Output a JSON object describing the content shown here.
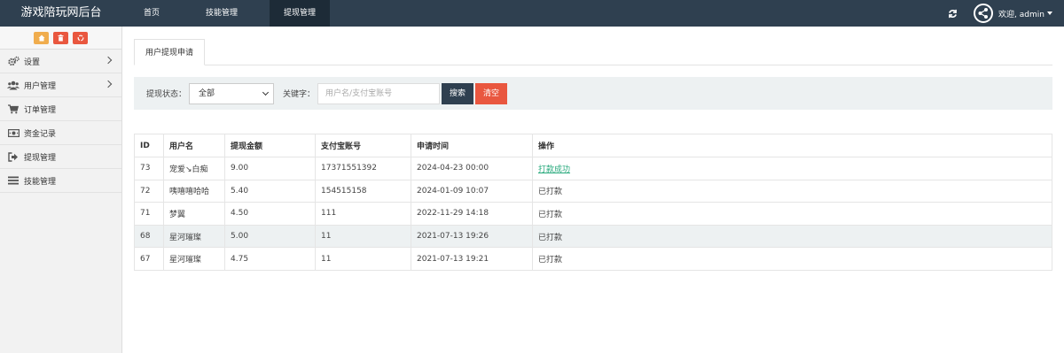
{
  "brand": "游戏陪玩网后台",
  "topnav": [
    {
      "label": "首页",
      "active": false
    },
    {
      "label": "技能管理",
      "active": false
    },
    {
      "label": "提现管理",
      "active": true
    }
  ],
  "user": {
    "greeting": "欢迎, admin"
  },
  "sidebar": {
    "items": [
      {
        "label": "设置",
        "icon": "gears-icon",
        "has_arrow": true
      },
      {
        "label": "用户管理",
        "icon": "users-icon",
        "has_arrow": true
      },
      {
        "label": "订单管理",
        "icon": "cart-icon",
        "has_arrow": false
      },
      {
        "label": "资金记录",
        "icon": "money-icon",
        "has_arrow": false
      },
      {
        "label": "提现管理",
        "icon": "sign-out-icon",
        "has_arrow": false
      },
      {
        "label": "技能管理",
        "icon": "list-icon",
        "has_arrow": false
      }
    ]
  },
  "tab": {
    "label": "用户提现申请"
  },
  "filter": {
    "status_label": "提现状态：",
    "status_value": "全部",
    "keyword_label": "关键字：",
    "keyword_placeholder": "用户名/支付宝账号",
    "search_label": "搜索",
    "clear_label": "清空"
  },
  "table": {
    "headers": [
      "ID",
      "用户名",
      "提现金额",
      "支付宝账号",
      "申请时间",
      "操作"
    ],
    "rows": [
      {
        "id": "73",
        "user": "宠爱↘白痴",
        "amount": "9.00",
        "account": "17371551392",
        "time": "2024-04-23 00:00",
        "action": "打款成功",
        "action_link": true,
        "highlight": false
      },
      {
        "id": "72",
        "user": "咦嘻嘻哈哈",
        "amount": "5.40",
        "account": "154515158",
        "time": "2024-01-09 10:07",
        "action": "已打款",
        "action_link": false,
        "highlight": false
      },
      {
        "id": "71",
        "user": "梦翼",
        "amount": "4.50",
        "account": "111",
        "time": "2022-11-29 14:18",
        "action": "已打款",
        "action_link": false,
        "highlight": false
      },
      {
        "id": "68",
        "user": "星河璀璨",
        "amount": "5.00",
        "account": "11",
        "time": "2021-07-13 19:26",
        "action": "已打款",
        "action_link": false,
        "highlight": true
      },
      {
        "id": "67",
        "user": "星河璀璨",
        "amount": "4.75",
        "account": "11",
        "time": "2021-07-13 19:21",
        "action": "已打款",
        "action_link": false,
        "highlight": false
      }
    ]
  },
  "colors": {
    "topbar": "#2f4050",
    "accent_red": "#e9573f",
    "accent_orange": "#f0ad4e",
    "link_green": "#27a97c"
  }
}
